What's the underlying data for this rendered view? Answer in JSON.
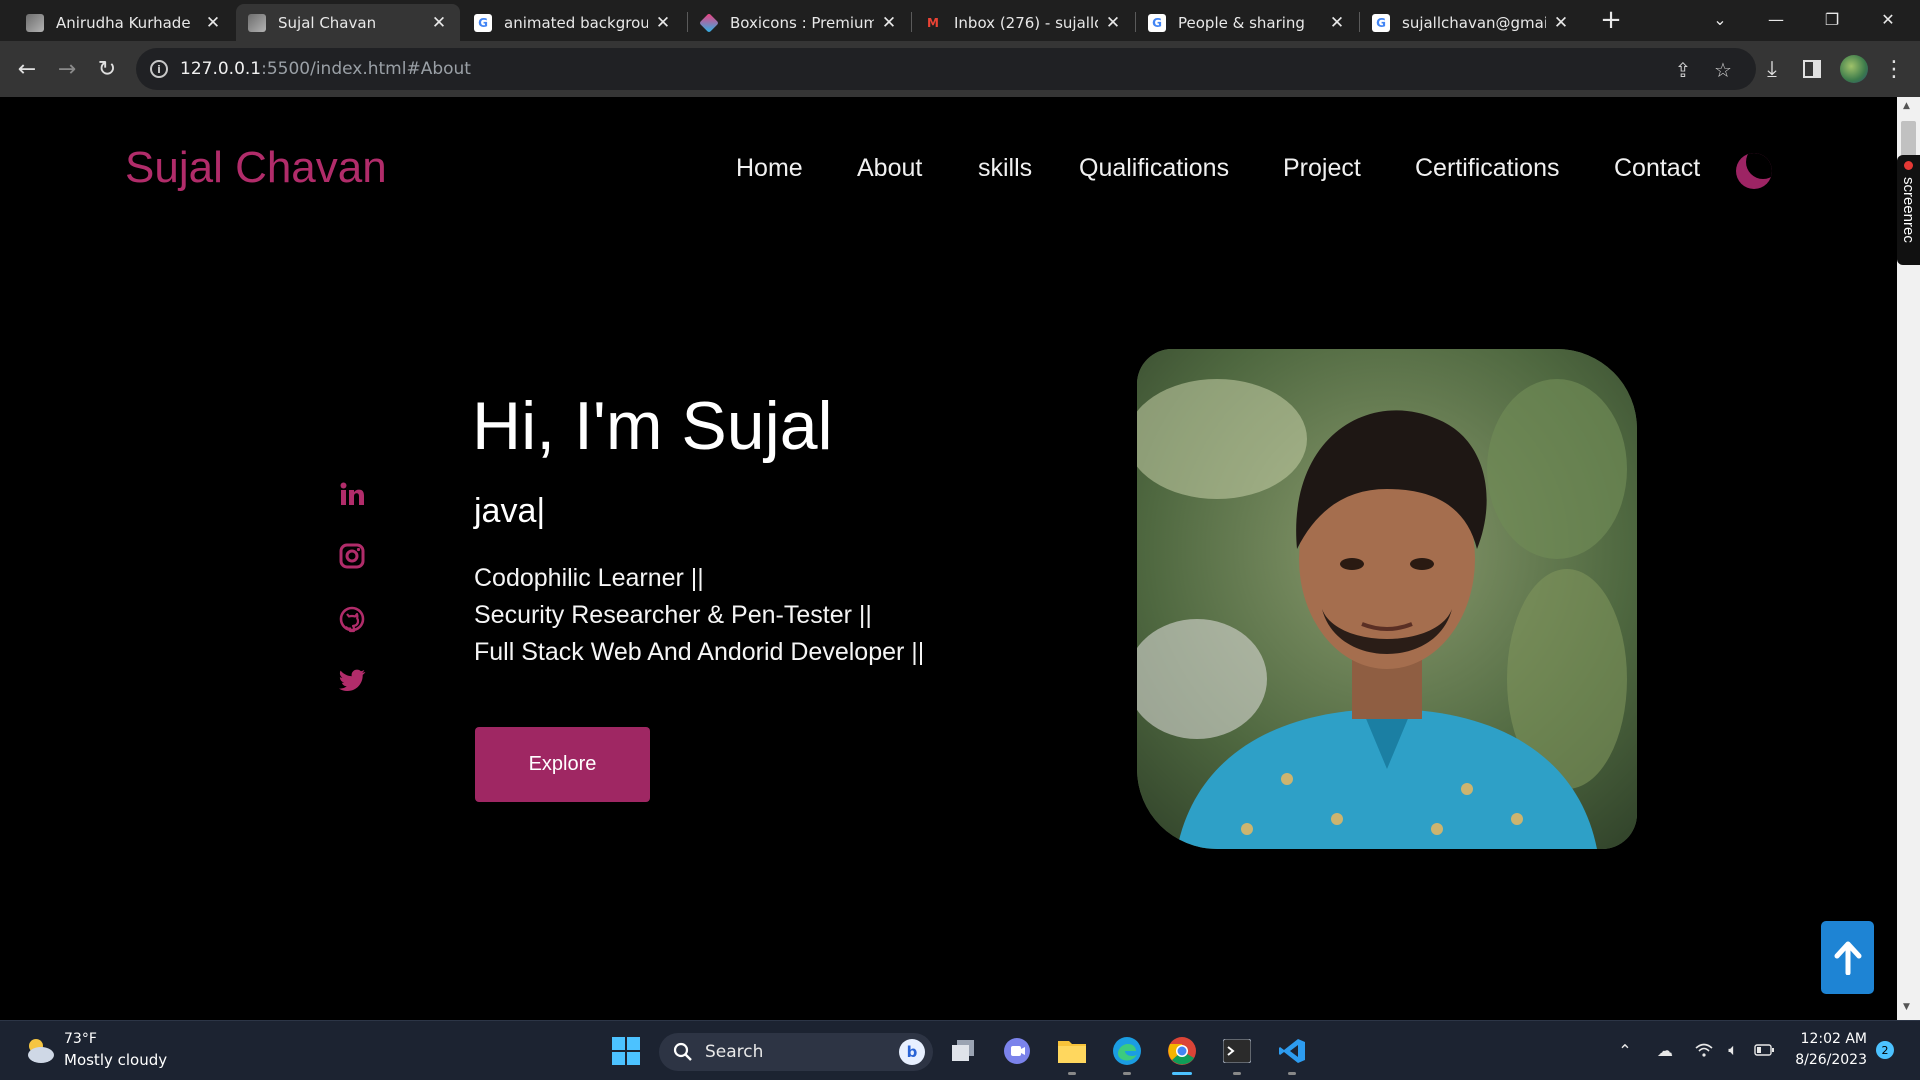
{
  "browser": {
    "tabs": [
      {
        "title": "Anirudha Kurhade",
        "icon": "photo-favicon"
      },
      {
        "title": "Sujal Chavan",
        "icon": "photo-favicon"
      },
      {
        "title": "animated background",
        "icon": "google-favicon"
      },
      {
        "title": "Boxicons : Premium w",
        "icon": "boxicons-favicon"
      },
      {
        "title": "Inbox (276) - sujallcha",
        "icon": "gmail-favicon"
      },
      {
        "title": "People & sharing",
        "icon": "google-favicon"
      },
      {
        "title": "sujallchavan@gmail.c",
        "icon": "google-favicon"
      }
    ],
    "active_tab_index": 1,
    "url_host": "127.0.0.1",
    "url_rest": ":5500/index.html#About"
  },
  "site": {
    "brand": "Sujal Chavan",
    "nav": [
      "Home",
      "About",
      "skills",
      "Qualifications",
      "Project",
      "Certifications",
      "Contact"
    ],
    "hero_title": "Hi, I'm Sujal",
    "typed_text": "java",
    "typed_caret": "|",
    "description": [
      "Codophilic Learner ||",
      "Security Researcher & Pen-Tester ||",
      "Full Stack Web And Andorid Developer ||"
    ],
    "button": "Explore",
    "social": [
      "linkedin-icon",
      "instagram-icon",
      "github-icon",
      "twitter-icon"
    ],
    "accent_color": "#9f2763",
    "extension_label": "screenrec"
  },
  "taskbar": {
    "weather_temp": "73°F",
    "weather_desc": "Mostly cloudy",
    "search_label": "Search",
    "time": "12:02 AM",
    "date": "8/26/2023",
    "notification_count": "2"
  }
}
